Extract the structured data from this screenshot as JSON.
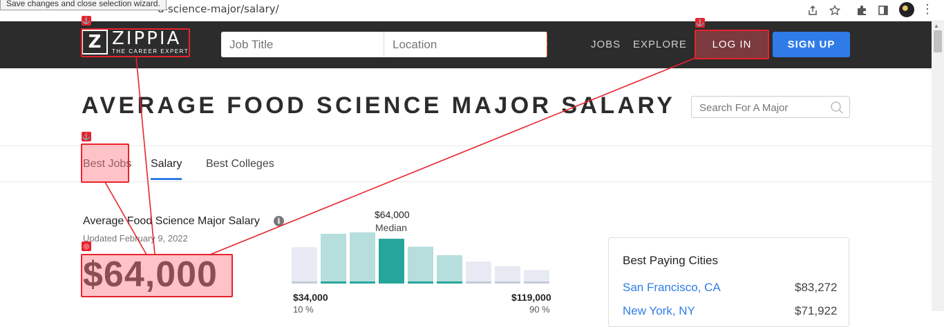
{
  "browser": {
    "url_fragment": "d-science-major/salary/",
    "tooltip": "Save changes and close selection wizard."
  },
  "header": {
    "logo_mark": "Z",
    "logo_name": "ZIPPIA",
    "logo_tagline": "THE CAREER EXPERT",
    "job_title_placeholder": "Job Title",
    "location_placeholder": "Location",
    "nav": [
      "JOBS",
      "EXPLORE"
    ],
    "login_label": "LOG IN",
    "signup_label": "SIGN UP"
  },
  "page": {
    "title": "AVERAGE FOOD SCIENCE MAJOR SALARY",
    "major_search_placeholder": "Search For A Major"
  },
  "tabs": [
    "Best Jobs",
    "Salary",
    "Best Colleges"
  ],
  "active_tab": "Salary",
  "salary": {
    "heading": "Average Food Science Major Salary",
    "updated": "Updated February 9, 2022",
    "amount": "$64,000",
    "median_value": "$64,000",
    "median_label": "Median",
    "low_value": "$34,000",
    "low_percentile": "10 %",
    "high_value": "$119,000",
    "high_percentile": "90 %"
  },
  "histogram": {
    "bars": [
      0.69,
      0.96,
      0.99,
      0.86,
      0.7,
      0.53,
      0.4,
      0.31,
      0.23
    ],
    "bar_colors": [
      "#e8eaf3",
      "#b6dedc",
      "#b6dedc",
      "#26a69a",
      "#b6dedc",
      "#b6dedc",
      "#e8eaf3",
      "#e8eaf3",
      "#e8eaf3"
    ],
    "base_colors": [
      "#c5cadb",
      "#26a69a",
      "#26a69a",
      "#26a69a",
      "#26a69a",
      "#26a69a",
      "#c5cadb",
      "#c5cadb",
      "#c5cadb"
    ]
  },
  "cities": {
    "title": "Best Paying Cities",
    "items": [
      {
        "name": "San Francisco, CA",
        "salary": "$83,272"
      },
      {
        "name": "New York, NY",
        "salary": "$71,922"
      }
    ]
  },
  "colors": {
    "header_bg": "#2c2c2c",
    "accent_orange": "#f15a22",
    "accent_blue": "#2f7ce8",
    "highlight_red": "#e8222b",
    "teal": "#26a69a"
  },
  "icons": {
    "share": "share-icon",
    "star": "star-icon",
    "extensions": "puzzle-icon",
    "sidepanel": "sidepanel-icon",
    "search": "search-icon",
    "info": "info-icon",
    "anchor": "anchor-icon",
    "target": "target-icon"
  }
}
